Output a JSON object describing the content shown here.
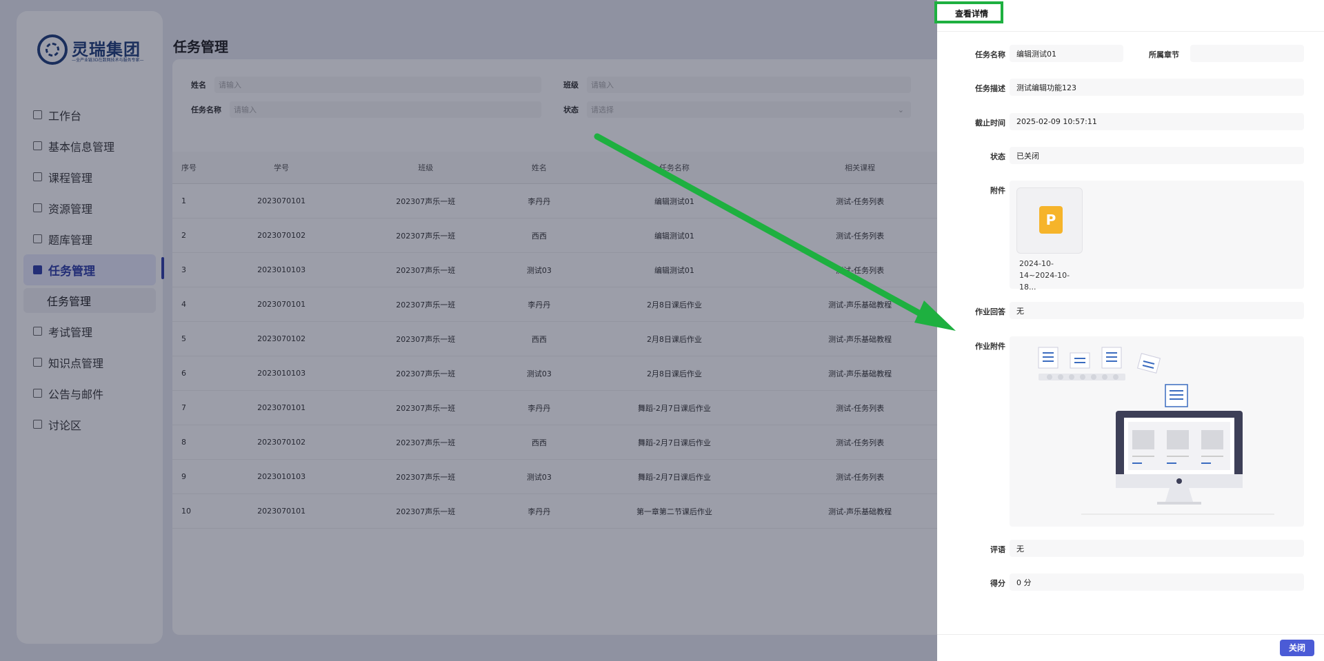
{
  "logo": {
    "name": "灵瑞集团",
    "slogan": "—全产业链3D在数网技术与服务专家—"
  },
  "sidebar": {
    "items": [
      {
        "label": "工作台"
      },
      {
        "label": "基本信息管理"
      },
      {
        "label": "课程管理"
      },
      {
        "label": "资源管理"
      },
      {
        "label": "题库管理"
      },
      {
        "label": "任务管理"
      },
      {
        "label": "任务管理"
      },
      {
        "label": "考试管理"
      },
      {
        "label": "知识点管理"
      },
      {
        "label": "公告与邮件"
      },
      {
        "label": "讨论区"
      }
    ]
  },
  "page": {
    "title": "任务管理"
  },
  "filters": {
    "name_label": "姓名",
    "name_placeholder": "请输入",
    "class_label": "班级",
    "class_placeholder": "请输入",
    "task_label": "任务名称",
    "task_placeholder": "请输入",
    "status_label": "状态",
    "status_placeholder": "请选择"
  },
  "table": {
    "headers": [
      "序号",
      "学号",
      "班级",
      "姓名",
      "任务名称",
      "相关课程"
    ],
    "rows": [
      [
        "1",
        "2023070101",
        "202307声乐一班",
        "李丹丹",
        "编辑测试01",
        "测试-任务列表"
      ],
      [
        "2",
        "2023070102",
        "202307声乐一班",
        "西西",
        "编辑测试01",
        "测试-任务列表"
      ],
      [
        "3",
        "2023010103",
        "202307声乐一班",
        "测试03",
        "编辑测试01",
        "测试-任务列表"
      ],
      [
        "4",
        "2023070101",
        "202307声乐一班",
        "李丹丹",
        "2月8日课后作业",
        "测试-声乐基础教程"
      ],
      [
        "5",
        "2023070102",
        "202307声乐一班",
        "西西",
        "2月8日课后作业",
        "测试-声乐基础教程"
      ],
      [
        "6",
        "2023010103",
        "202307声乐一班",
        "测试03",
        "2月8日课后作业",
        "测试-声乐基础教程"
      ],
      [
        "7",
        "2023070101",
        "202307声乐一班",
        "李丹丹",
        "舞蹈-2月7日课后作业",
        "测试-任务列表"
      ],
      [
        "8",
        "2023070102",
        "202307声乐一班",
        "西西",
        "舞蹈-2月7日课后作业",
        "测试-任务列表"
      ],
      [
        "9",
        "2023010103",
        "202307声乐一班",
        "测试03",
        "舞蹈-2月7日课后作业",
        "测试-任务列表"
      ],
      [
        "10",
        "2023070101",
        "202307声乐一班",
        "李丹丹",
        "第一章第二节课后作业",
        "测试-声乐基础教程"
      ]
    ]
  },
  "drawer": {
    "title": "查看详情",
    "task_name_label": "任务名称",
    "task_name": "编辑测试01",
    "chapter_label": "所属章节",
    "chapter": "",
    "desc_label": "任务描述",
    "desc": "测试编辑功能123",
    "deadline_label": "截止时间",
    "deadline": "2025-02-09 10:57:11",
    "status_label": "状态",
    "status": "已关闭",
    "attachment_label": "附件",
    "attachment_name_line1": "2024-10-",
    "attachment_name_line2": "14~2024-10-18...",
    "attachment_icon": "P",
    "answer_label": "作业回答",
    "answer": "无",
    "hw_attach_label": "作业附件",
    "comment_label": "评语",
    "comment": "无",
    "score_label": "得分",
    "score": "0 分",
    "close_label": "关闭"
  },
  "colors": {
    "accent": "#4b5bd6",
    "highlight": "#1eb040",
    "arrow": "#1eb040",
    "file_icon": "#f6b42a"
  }
}
